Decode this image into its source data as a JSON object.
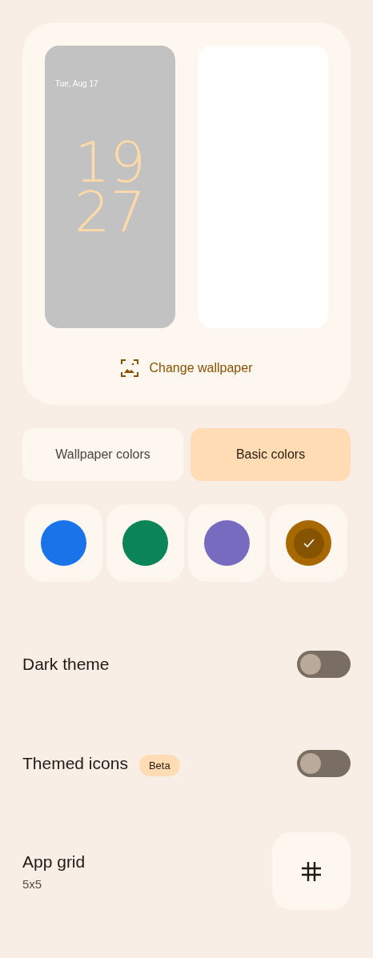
{
  "preview": {
    "lock_screen": {
      "date": "Tue, Aug 17",
      "clock_hours": "19",
      "clock_minutes": "27"
    },
    "change_wallpaper": "Change wallpaper"
  },
  "color_tabs": [
    {
      "label": "Wallpaper colors",
      "selected": false
    },
    {
      "label": "Basic colors",
      "selected": true
    }
  ],
  "swatches": [
    {
      "color": "#1a73e8",
      "selected": false
    },
    {
      "color": "#0b8457",
      "selected": false
    },
    {
      "color": "#776bc0",
      "selected": false
    },
    {
      "color": "#a86800",
      "selected": true
    }
  ],
  "settings": [
    {
      "kind": "toggle",
      "title": "Dark theme",
      "on": false
    },
    {
      "kind": "toggle",
      "title": "Themed icons",
      "badge": "Beta",
      "on": false
    },
    {
      "kind": "grid",
      "title": "App grid",
      "subtitle": "5x5"
    }
  ]
}
